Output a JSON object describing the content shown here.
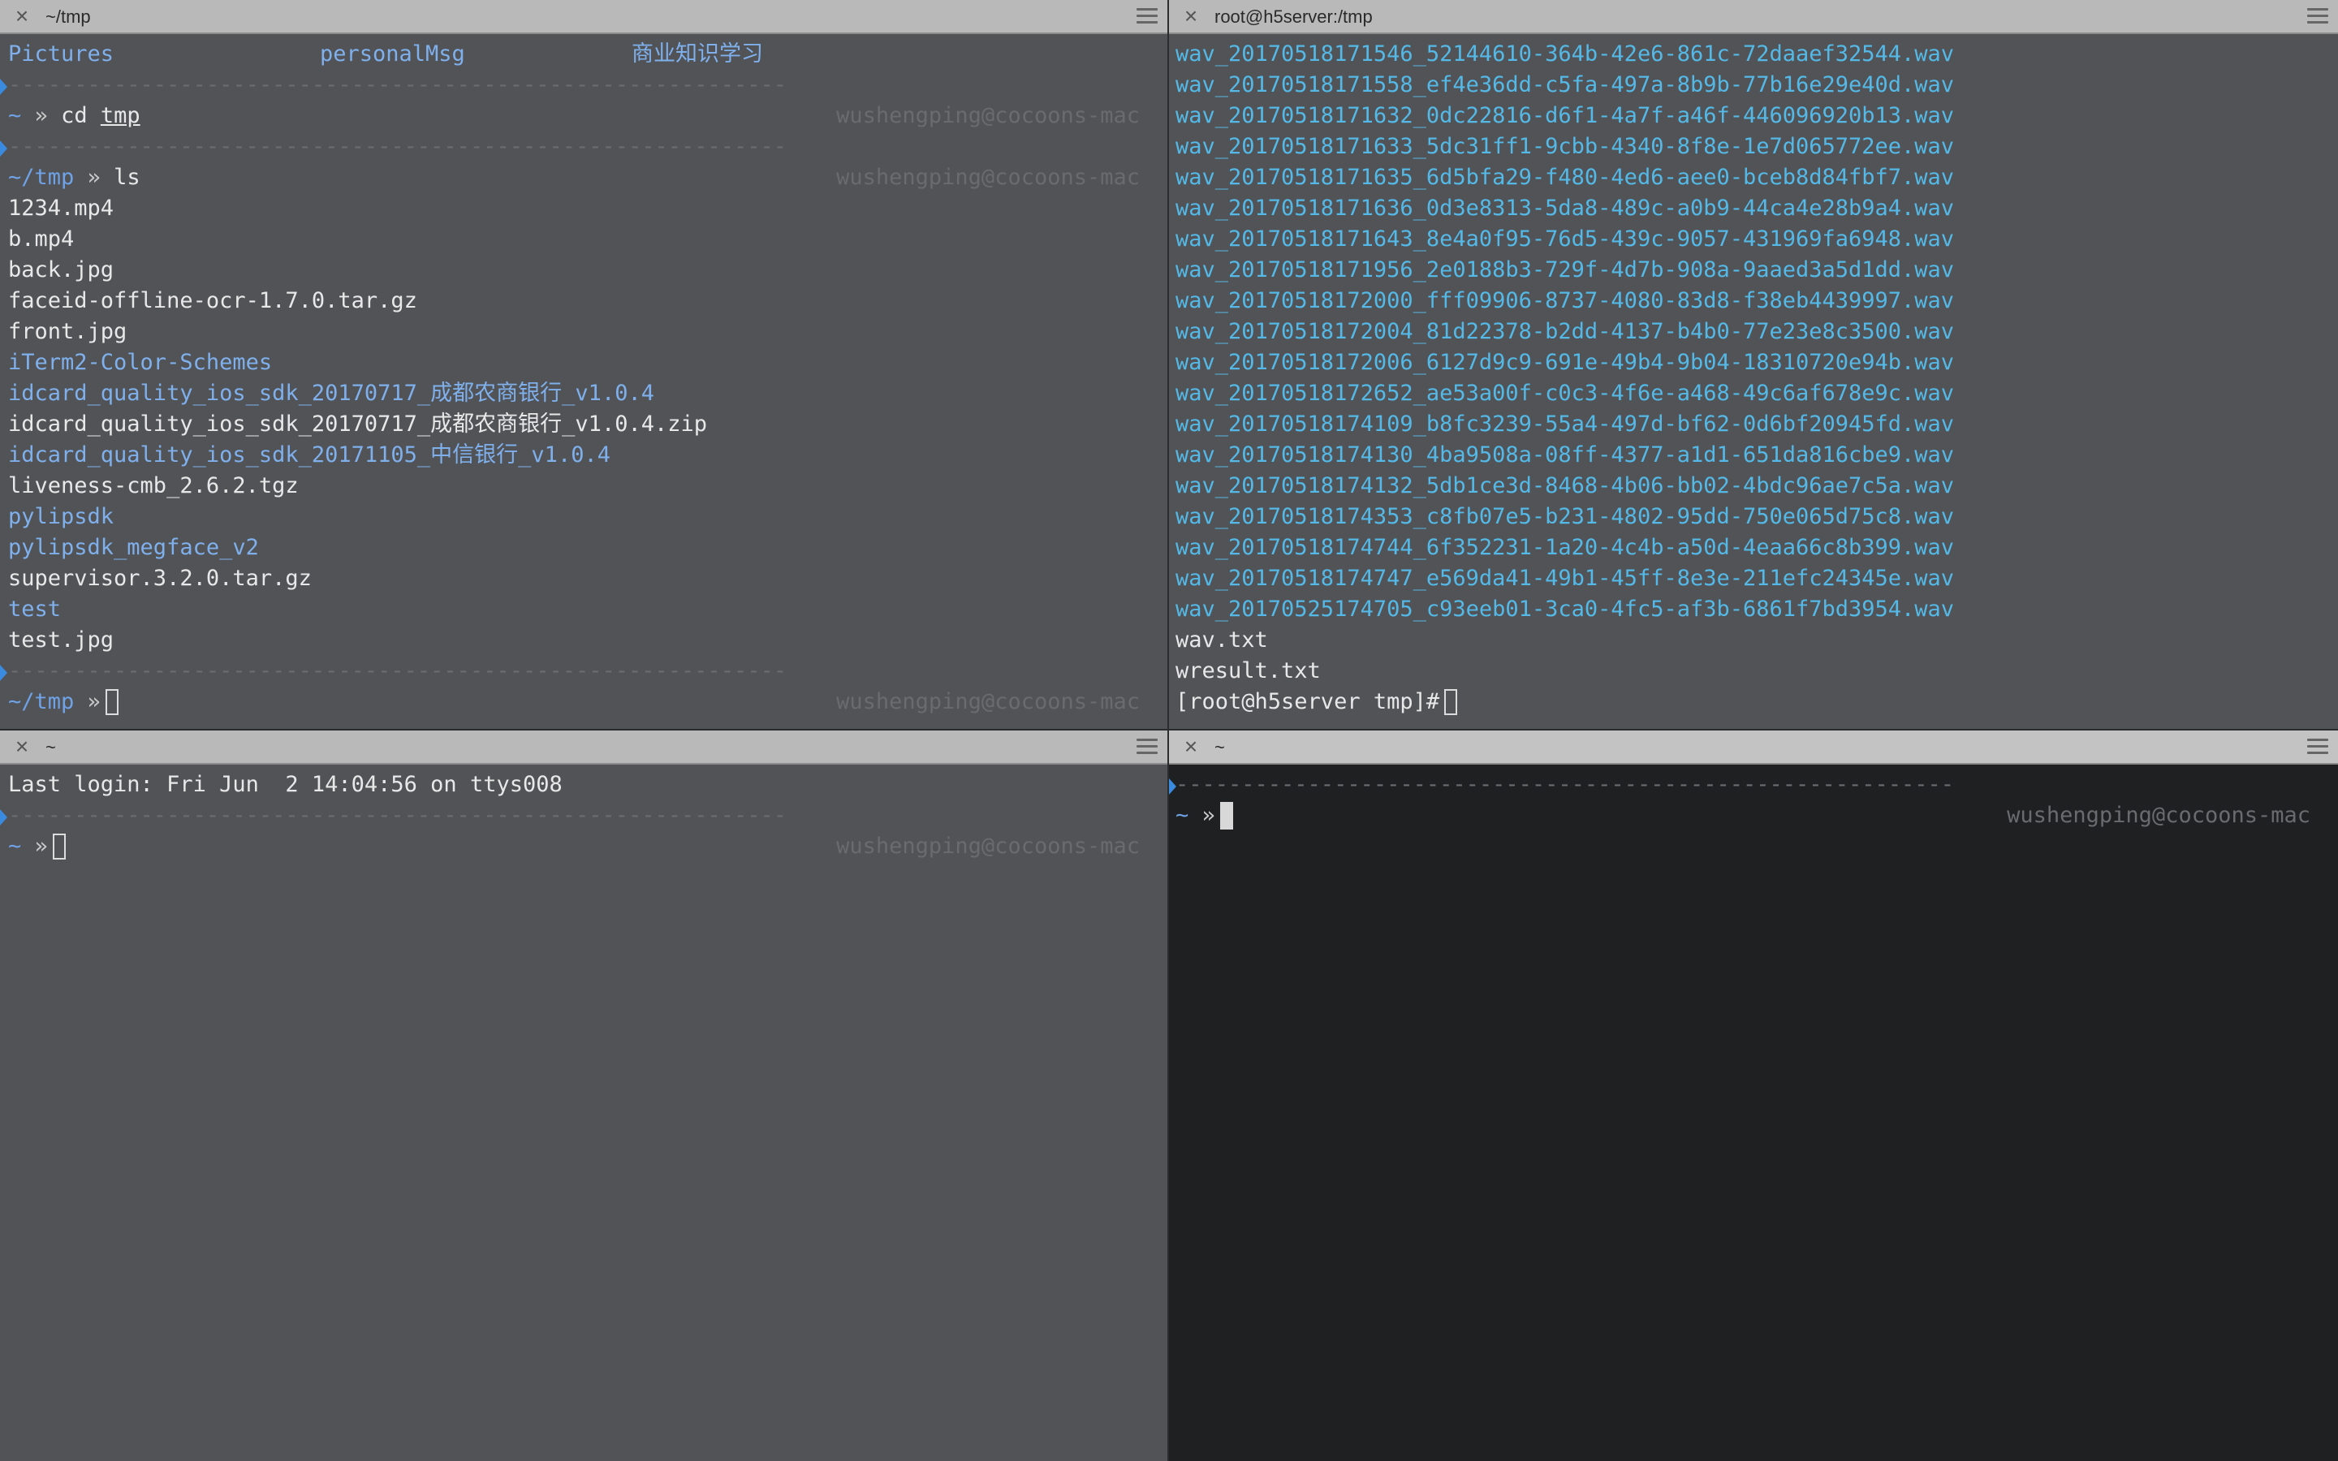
{
  "panes": {
    "top_left": {
      "title": "~/tmp",
      "columns_row": [
        "Pictures",
        "personalMsg",
        "商业知识学习"
      ],
      "dashes": "-----------------------------------------------------------",
      "prompt1": {
        "tilde": "~",
        "arrow": "»",
        "cmd": "cd ",
        "arg": "tmp",
        "right": "wushengping@cocoons-mac"
      },
      "prompt2": {
        "tilde": "~/tmp",
        "arrow": "»",
        "cmd": "ls",
        "right": "wushengping@cocoons-mac"
      },
      "files": [
        {
          "name": "1234.mp4",
          "color": "white"
        },
        {
          "name": "b.mp4",
          "color": "white"
        },
        {
          "name": "back.jpg",
          "color": "white"
        },
        {
          "name": "faceid-offline-ocr-1.7.0.tar.gz",
          "color": "white"
        },
        {
          "name": "front.jpg",
          "color": "white"
        },
        {
          "name": "iTerm2-Color-Schemes",
          "color": "blue"
        },
        {
          "name": "idcard_quality_ios_sdk_20170717_成都农商银行_v1.0.4",
          "color": "blue"
        },
        {
          "name": "idcard_quality_ios_sdk_20170717_成都农商银行_v1.0.4.zip",
          "color": "white"
        },
        {
          "name": "idcard_quality_ios_sdk_20171105_中信银行_v1.0.4",
          "color": "blue"
        },
        {
          "name": "liveness-cmb_2.6.2.tgz",
          "color": "white"
        },
        {
          "name": "pylipsdk",
          "color": "blue"
        },
        {
          "name": "pylipsdk_megface_v2",
          "color": "blue"
        },
        {
          "name": "supervisor.3.2.0.tar.gz",
          "color": "white"
        },
        {
          "name": "test",
          "color": "blue"
        },
        {
          "name": "test.jpg",
          "color": "white"
        }
      ],
      "prompt3": {
        "tilde": "~/tmp",
        "arrow": "»",
        "right": "wushengping@cocoons-mac"
      }
    },
    "top_right": {
      "title": "root@h5server:/tmp",
      "files": [
        "wav_20170518171546_52144610-364b-42e6-861c-72daaef32544.wav",
        "wav_20170518171558_ef4e36dd-c5fa-497a-8b9b-77b16e29e40d.wav",
        "wav_20170518171632_0dc22816-d6f1-4a7f-a46f-446096920b13.wav",
        "wav_20170518171633_5dc31ff1-9cbb-4340-8f8e-1e7d065772ee.wav",
        "wav_20170518171635_6d5bfa29-f480-4ed6-aee0-bceb8d84fbf7.wav",
        "wav_20170518171636_0d3e8313-5da8-489c-a0b9-44ca4e28b9a4.wav",
        "wav_20170518171643_8e4a0f95-76d5-439c-9057-431969fa6948.wav",
        "wav_20170518171956_2e0188b3-729f-4d7b-908a-9aaed3a5d1dd.wav",
        "wav_20170518172000_fff09906-8737-4080-83d8-f38eb4439997.wav",
        "wav_20170518172004_81d22378-b2dd-4137-b4b0-77e23e8c3500.wav",
        "wav_20170518172006_6127d9c9-691e-49b4-9b04-18310720e94b.wav",
        "wav_20170518172652_ae53a00f-c0c3-4f6e-a468-49c6af678e9c.wav",
        "wav_20170518174109_b8fc3239-55a4-497d-bf62-0d6bf20945fd.wav",
        "wav_20170518174130_4ba9508a-08ff-4377-a1d1-651da816cbe9.wav",
        "wav_20170518174132_5db1ce3d-8468-4b06-bb02-4bdc96ae7c5a.wav",
        "wav_20170518174353_c8fb07e5-b231-4802-95dd-750e065d75c8.wav",
        "wav_20170518174744_6f352231-1a20-4c4b-a50d-4eaa66c8b399.wav",
        "wav_20170518174747_e569da41-49b1-45ff-8e3e-211efc24345e.wav",
        "wav_20170525174705_c93eeb01-3ca0-4fc5-af3b-6861f7bd3954.wav"
      ],
      "plain_files": [
        "wav.txt",
        "wresult.txt"
      ],
      "prompt": "[root@h5server tmp]#"
    },
    "bottom_left": {
      "title": "~",
      "last_login": "Last login: Fri Jun  2 14:04:56 on ttys008",
      "prompt": {
        "tilde": "~",
        "arrow": "»",
        "right": "wushengping@cocoons-mac"
      }
    },
    "bottom_right": {
      "title": "~",
      "prompt": {
        "tilde": "~",
        "arrow": "»",
        "right": "wushengping@cocoons-mac"
      }
    }
  },
  "colors": {
    "pane_bg": "#525357",
    "active_pane_bg": "#1f2022",
    "dir_blue": "#7fb0ec",
    "wav_cyan": "#54b9e6",
    "prompt_marker": "#3a8ae0"
  },
  "icons": {
    "close": "close-icon",
    "menu": "hamburger-menu-icon"
  }
}
